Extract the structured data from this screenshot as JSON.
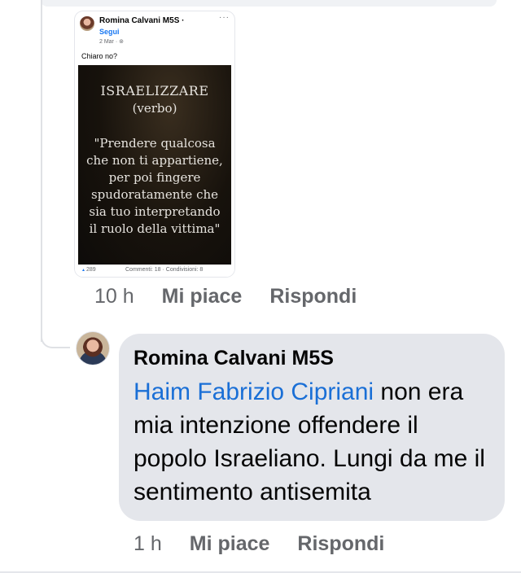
{
  "embedded_post": {
    "author": "Romina Calvani M5S ·",
    "follow_label": "Segui",
    "date": "2 Mar · ⊚",
    "caption": "Chiaro no?",
    "poster": {
      "word": "ISRAELIZZARE",
      "type": "(verbo)",
      "definition": "\"Prendere qualcosa\nche non ti appartiene,\nper poi fingere\nspudoratamente che\nsia tuo interpretando\nil ruolo della vittima\""
    },
    "reactions": "289",
    "stats": "Commenti: 18 · Condivisioni: 8"
  },
  "comment_actions": {
    "time": "10 h",
    "like": "Mi piace",
    "reply": "Rispondi"
  },
  "reply": {
    "author": "Romina Calvani M5S",
    "mention": "Haim Fabrizio Cipriani",
    "text": " non era mia intenzione offendere il popolo Israeliano. Lungi da me il sentimento antisemita",
    "time": "1 h",
    "like": "Mi piace",
    "reply_label": "Rispondi"
  },
  "colors": {
    "mention": "#1a6fd6",
    "bubble": "#e4e6eb",
    "muted": "#65676b"
  }
}
